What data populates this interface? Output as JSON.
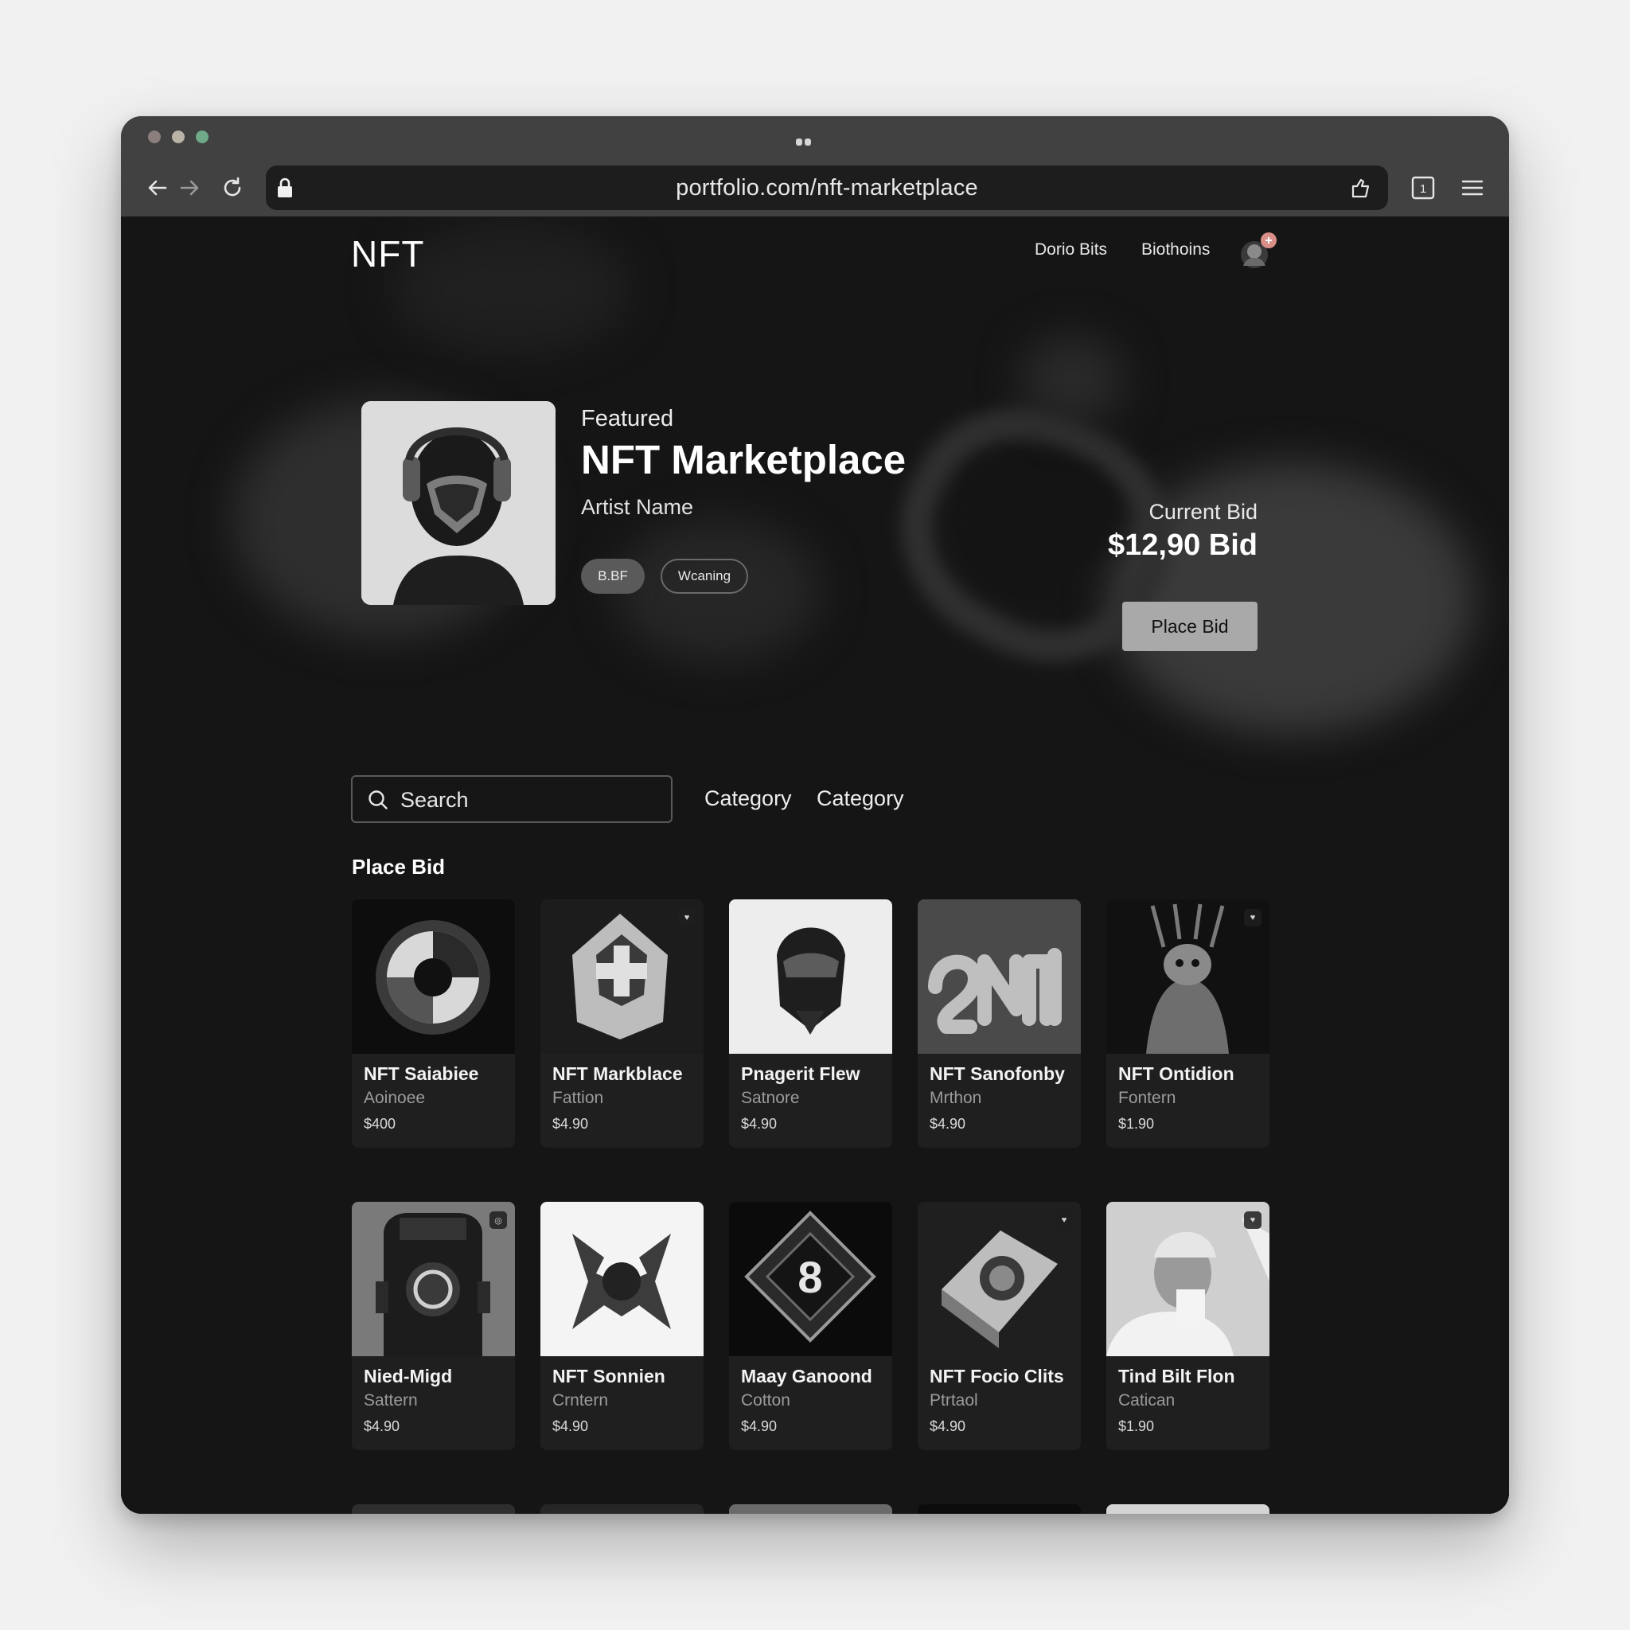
{
  "browser": {
    "url": "portfolio.com/nft-marketplace"
  },
  "header": {
    "brand": "NFT",
    "nav": [
      "Dorio Bits",
      "Biothoins"
    ]
  },
  "featured": {
    "label": "Featured",
    "title": "NFT Marketplace",
    "artist": "Artist Name",
    "chips": [
      "B.BF",
      "Wcaning"
    ],
    "bid_label": "Current Bid",
    "bid_value": "$12,90 Bid",
    "bid_button": "Place Bid"
  },
  "filters": {
    "search_placeholder": "Search",
    "categories": [
      "Category",
      "Category"
    ]
  },
  "section": {
    "title": "Place Bid"
  },
  "cards": [
    {
      "title": "NFT Saiabiee",
      "sub": "Aoinoee",
      "price": "$400"
    },
    {
      "title": "NFT Markblace",
      "sub": "Fattion",
      "price": "$4.90"
    },
    {
      "title": "Pnagerit Flew",
      "sub": "Satnore",
      "price": "$4.90"
    },
    {
      "title": "NFT Sanofonby",
      "sub": "Mrthon",
      "price": "$4.90"
    },
    {
      "title": "NFT Ontidion",
      "sub": "Fontern",
      "price": "$1.90"
    },
    {
      "title": "Nied-Migd",
      "sub": "Sattern",
      "price": "$4.90"
    },
    {
      "title": "NFT Sonnien",
      "sub": "Crntern",
      "price": "$4.90"
    },
    {
      "title": "Maay Ganoond",
      "sub": "Cotton",
      "price": "$4.90"
    },
    {
      "title": "NFT Focio Clits",
      "sub": "Ptrtaol",
      "price": "$4.90"
    },
    {
      "title": "Tind Bilt Flon",
      "sub": "Catican",
      "price": "$1.90"
    }
  ]
}
